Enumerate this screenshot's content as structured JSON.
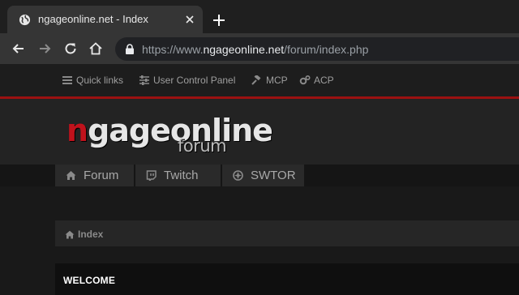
{
  "browser": {
    "tab": {
      "title": "ngageonline.net - Index",
      "favicon": "globe-icon"
    },
    "newtab_icon": "plus-icon",
    "toolbar": {
      "back": "arrow-left-icon",
      "forward": "arrow-right-icon",
      "reload": "reload-icon",
      "home": "home-icon"
    },
    "url": {
      "scheme": "https://www.",
      "host": "ngageonline.net",
      "path": "/forum/index.php"
    }
  },
  "topnav": {
    "quick_links": "Quick links",
    "ucp": "User Control Panel",
    "mcp": "MCP",
    "acp": "ACP"
  },
  "logo": {
    "first": "n",
    "rest": "gageonline",
    "sub": "forum"
  },
  "tabs": [
    {
      "label": "Forum",
      "icon": "home-icon"
    },
    {
      "label": "Twitch",
      "icon": "twitch-icon"
    },
    {
      "label": "SWTOR",
      "icon": "swtor-icon"
    }
  ],
  "breadcrumb": {
    "label": "Index"
  },
  "welcome": {
    "label": "WELCOME"
  },
  "colors": {
    "accent_red": "#9b1111",
    "logo_red": "#c0121c",
    "background": "#191919"
  }
}
